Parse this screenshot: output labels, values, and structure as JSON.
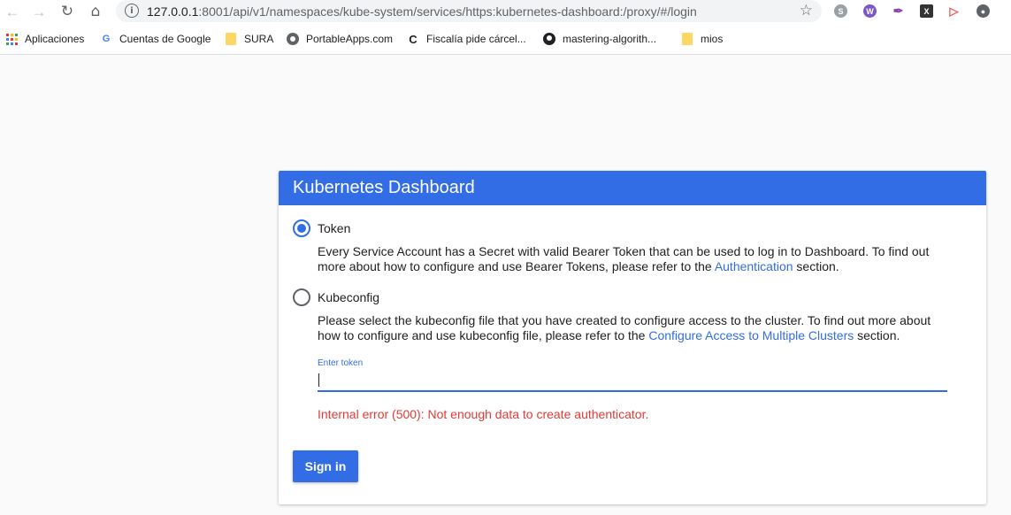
{
  "browser": {
    "url_host": "127.0.0.1",
    "url_path": ":8001/api/v1/namespaces/kube-system/services/https:kubernetes-dashboard:/proxy/#/login"
  },
  "bookmarks": [
    {
      "label": "Aplicaciones",
      "icon": "apps-grid-icon"
    },
    {
      "label": "Cuentas de Google",
      "icon": "google-icon"
    },
    {
      "label": "SURA",
      "icon": "folder-icon"
    },
    {
      "label": "PortableApps.com",
      "icon": "portableapps-icon"
    },
    {
      "label": "Fiscalía pide cárcel...",
      "icon": "news-icon"
    },
    {
      "label": "mastering-algorith...",
      "icon": "github-icon"
    },
    {
      "label": "mios",
      "icon": "folder-icon"
    }
  ],
  "login": {
    "title": "Kubernetes Dashboard",
    "token_option": {
      "label": "Token",
      "checked": true,
      "desc_pre": "Every Service Account has a Secret with valid Bearer Token that can be used to log in to Dashboard. To find out more about how to configure and use Bearer Tokens, please refer to the ",
      "link": "Authentication",
      "desc_post": " section."
    },
    "kubeconfig_option": {
      "label": "Kubeconfig",
      "checked": false,
      "desc_pre": "Please select the kubeconfig file that you have created to configure access to the cluster. To find out more about how to configure and use kubeconfig file, please refer to the ",
      "link": "Configure Access to Multiple Clusters",
      "desc_post": " section."
    },
    "token_field_label": "Enter token",
    "token_value": "",
    "error": "Internal error (500): Not enough data to create authenticator.",
    "signin_label": "Sign in"
  },
  "colors": {
    "accent": "#326de6",
    "error": "#e53935",
    "background": "#fafafa"
  }
}
